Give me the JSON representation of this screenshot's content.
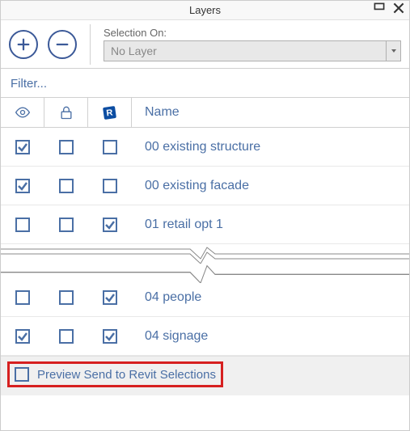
{
  "panel": {
    "title": "Layers",
    "selection_label": "Selection On:",
    "selection_value": "No Layer",
    "filter_placeholder": "Filter...",
    "name_header": "Name",
    "footer_label": "Preview Send to Revit Selections",
    "footer_checked": false
  },
  "rows": [
    {
      "visible": true,
      "locked": false,
      "revit": false,
      "name": "00 existing structure"
    },
    {
      "visible": true,
      "locked": false,
      "revit": false,
      "name": "00 existing facade"
    },
    {
      "visible": false,
      "locked": false,
      "revit": true,
      "name": "01 retail opt 1"
    }
  ],
  "rows2": [
    {
      "visible": false,
      "locked": false,
      "revit": true,
      "name": "04 people"
    },
    {
      "visible": true,
      "locked": false,
      "revit": true,
      "name": "04 signage"
    }
  ]
}
